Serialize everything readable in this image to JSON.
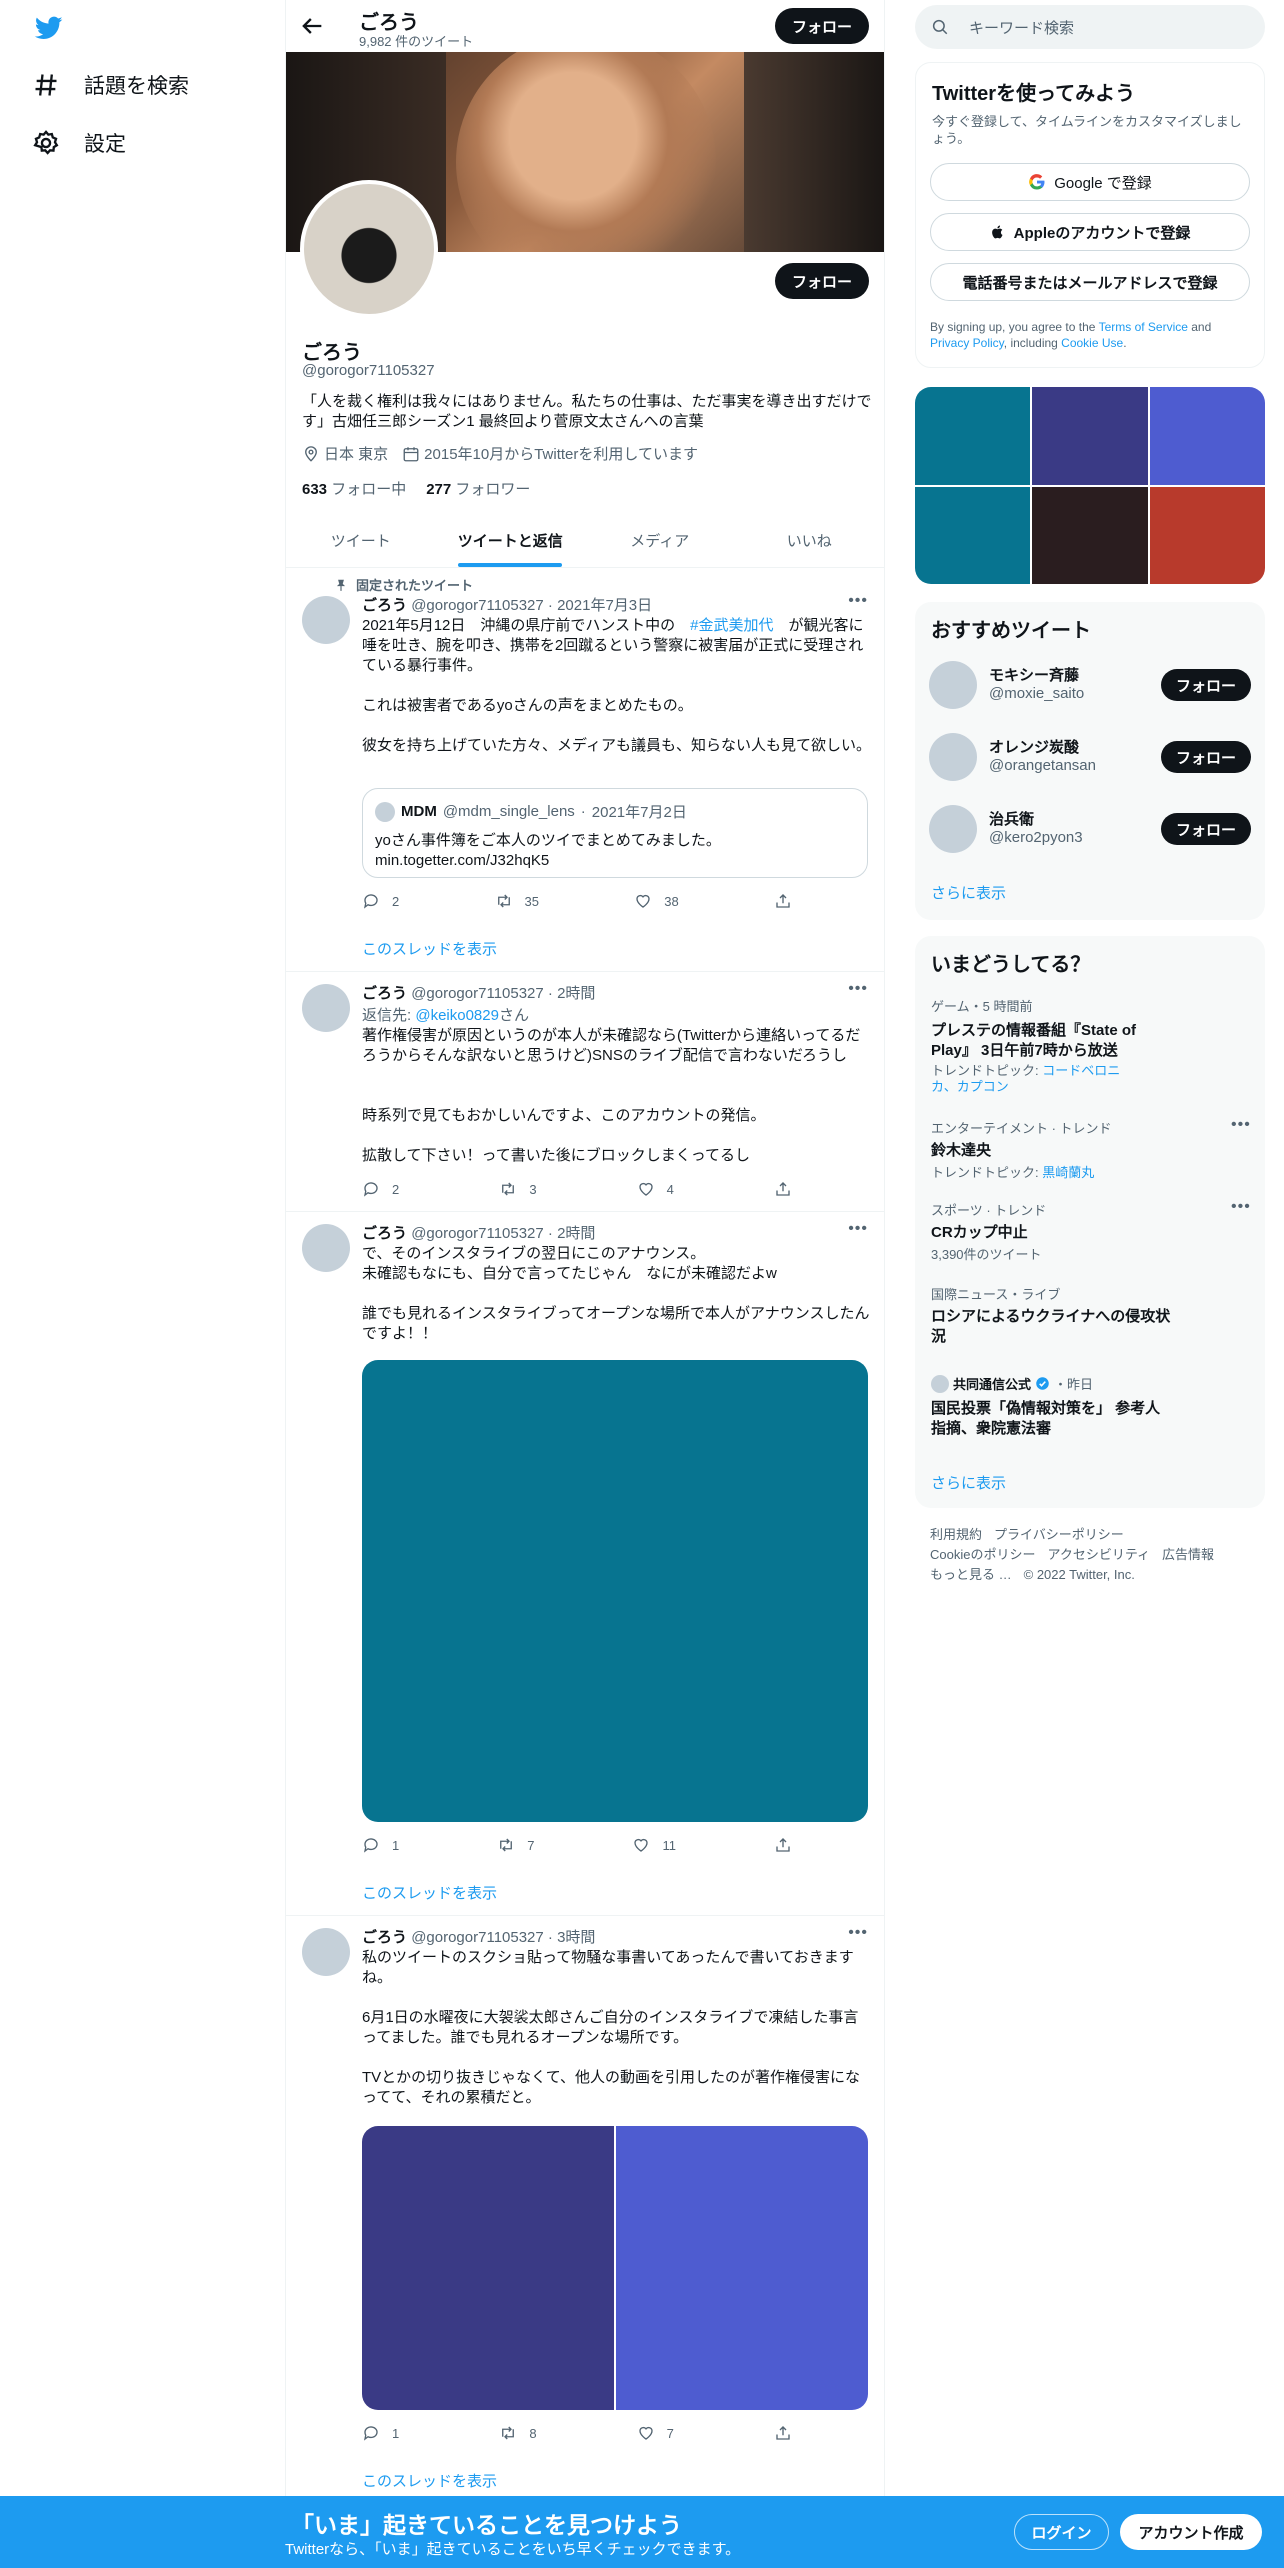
{
  "nav": {
    "explore_label": "話題を検索",
    "settings_label": "設定"
  },
  "header": {
    "name": "ごろう",
    "tweet_count": "9,982 件のツイート",
    "follow_label": "フォロー"
  },
  "profile": {
    "name": "ごろう",
    "handle": "@gorogor71105327",
    "follow_label": "フォロー",
    "bio": "「人を裁く権利は我々にはありません。私たちの仕事は、ただ事実を導き出すだけです」古畑任三郎シーズン1 最終回より菅原文太さんへの言葉",
    "location": "日本 東京",
    "joined": "2015年10月からTwitterを利用しています",
    "following_count": "633",
    "following_label": "フォロー中",
    "followers_count": "277",
    "followers_label": "フォロワー"
  },
  "tabs": [
    "ツイート",
    "ツイートと返信",
    "メディア",
    "いいね"
  ],
  "tweets": [
    {
      "pinned_label": "固定されたツイート",
      "name": "ごろう",
      "handle": "@gorogor71105327",
      "time": "2021年7月3日",
      "text_before": "2021年5月12日　沖縄の県庁前でハンスト中の　",
      "hashtag": "#金武美加代",
      "text_line1_after": "　が観光客に",
      "text_rest": "唾を吐き、腕を叩き、携帯を2回蹴るという警察に被害届が正式に受理されている暴行事件。\n\nこれは被害者であるyoさんの声をまとめたもの。\n\n彼女を持ち上げていた方々、メディアも議員も、知らない人も見て欲しい。",
      "quote": {
        "name": "MDM",
        "handle": "@mdm_single_lens",
        "time": "2021年7月2日",
        "text": "yoさん事件簿をご本人のツイでまとめてみました。",
        "url": "min.togetter.com/J32hqK5"
      },
      "replies": "2",
      "retweets": "35",
      "likes": "38",
      "thread_label": "このスレッドを表示"
    },
    {
      "name": "ごろう",
      "handle": "@gorogor71105327",
      "time": "2時間",
      "reply_to_prefix": "返信先: ",
      "reply_to_handle": "@keiko0829",
      "reply_to_suffix": "さん",
      "text": "著作権侵害が原因というのが本人が未確認なら(Twitterから連絡いってるだろうからそんな訳ないと思うけど)SNSのライブ配信で言わないだろうし\n\n\n時系列で見てもおかしいんですよ、このアカウントの発信。\n\n拡散して下さい！って書いた後にブロックしまくってるし",
      "replies": "2",
      "retweets": "3",
      "likes": "4"
    },
    {
      "name": "ごろう",
      "handle": "@gorogor71105327",
      "time": "2時間",
      "text": "で、そのインスタライブの翌日にこのアナウンス。\n未確認もなにも、自分で言ってたじゃん　なにが未確認だよw\n\n誰でも見れるインスタライブってオープンな場所で本人がアナウンスしたんですよ！！",
      "media_color": "#077490",
      "replies": "1",
      "retweets": "7",
      "likes": "11",
      "thread_label": "このスレッドを表示"
    },
    {
      "name": "ごろう",
      "handle": "@gorogor71105327",
      "time": "3時間",
      "text": "私のツイートのスクショ貼って物騒な事書いてあったんで書いておきますね。\n\n6月1日の水曜夜に大袈裟太郎さんご自分のインスタライブで凍結した事言ってました。誰でも見れるオープンな場所です。\n\nTVとかの切り抜きじゃなくて、他人の動画を引用したのが著作権侵害になってて、それの累積だと。",
      "media_colors": [
        "#3a3a85",
        "#4e5cd0"
      ],
      "replies": "1",
      "retweets": "8",
      "likes": "7",
      "thread_label": "このスレッドを表示"
    }
  ],
  "search": {
    "placeholder": "キーワード検索"
  },
  "signup_card": {
    "title": "Twitterを使ってみよう",
    "subtitle": "今すぐ登録して、タイムラインをカスタマイズしましょう。",
    "google_label": "Google で登録",
    "apple_label": "Appleのアカウントで登録",
    "phone_label": "電話番号またはメールアドレスで登録",
    "terms_before": "By signing up, you agree to the ",
    "terms_link": "Terms of Service",
    "terms_mid": " and ",
    "privacy_link": "Privacy Policy",
    "terms_mid2": ", including ",
    "cookie_link": "Cookie Use",
    "terms_end": "."
  },
  "media_grid_colors": [
    "#077490",
    "#3a3a85",
    "#4e5cd0",
    "#077490",
    "#2a1d1f",
    "#b83a2c"
  ],
  "suggested": {
    "title": "おすすめツイート",
    "follow_label": "フォロー",
    "users": [
      {
        "name": "モキシー斉藤",
        "handle": "@moxie_saito"
      },
      {
        "name": "オレンジ炭酸",
        "handle": "@orangetansan"
      },
      {
        "name": "治兵衛",
        "handle": "@kero2pyon3"
      }
    ],
    "show_more": "さらに表示"
  },
  "trends": {
    "title": "いまどうしてる？",
    "items": [
      {
        "category": "ゲーム・5 時間前",
        "title": "プレステの情報番組『State of Play』 3日午前7時から放送",
        "topic_prefix": "トレンドトピック: ",
        "topic": "コードベロニカ、カプコン"
      },
      {
        "category": "エンターテイメント · トレンド",
        "title": "鈴木達央",
        "topic_prefix": "トレンドトピック: ",
        "topic": "黒崎蘭丸"
      },
      {
        "category": "スポーツ · トレンド",
        "title": "CRカップ中止",
        "count": "3,390件のツイート"
      },
      {
        "category": "国際ニュース・ライブ",
        "title": "ロシアによるウクライナへの侵攻状況"
      },
      {
        "source": "共同通信公式",
        "source_time": "・昨日",
        "title": "国民投票「偽情報対策を」 参考人指摘、衆院憲法審"
      }
    ],
    "show_more": "さらに表示"
  },
  "footer": {
    "terms": "利用規約",
    "privacy": "プライバシーポリシー",
    "cookie": "Cookieのポリシー",
    "accessibility": "アクセシビリティ",
    "ads": "広告情報",
    "more": "もっと見る …",
    "copyright": "© 2022 Twitter, Inc."
  },
  "bottom_bar": {
    "title": "「いま」起きていることを見つけよう",
    "subtitle": "Twitterなら、「いま」起きていることをいち早くチェックできます。",
    "login_label": "ログイン",
    "signup_label": "アカウント作成"
  },
  "colors": {
    "accent": "#1d9bf0",
    "bottom_bar": "#1d9bf0"
  }
}
